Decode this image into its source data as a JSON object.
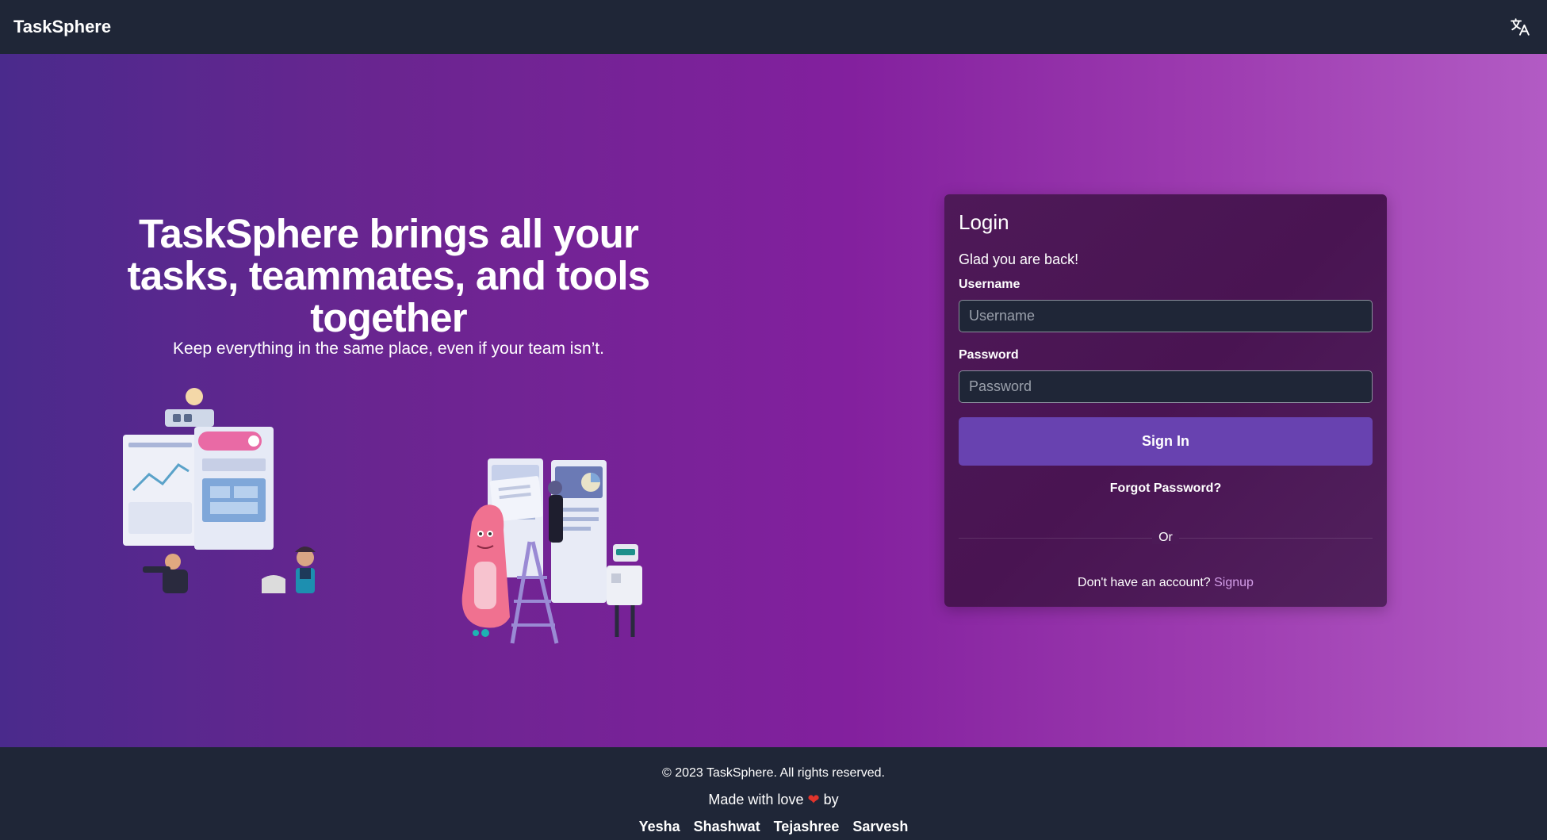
{
  "navbar": {
    "brand": "TaskSphere",
    "language_icon": "translate-icon"
  },
  "hero": {
    "headline": "TaskSphere brings all your tasks, teammates, and tools together",
    "subheadline": "Keep everything in the same place, even if your team isn’t."
  },
  "login": {
    "title": "Login",
    "subtitle": "Glad you are back!",
    "username_label": "Username",
    "username_placeholder": "Username",
    "password_label": "Password",
    "password_placeholder": "Password",
    "signin_label": "Sign In",
    "forgot_label": "Forgot Password?",
    "divider_text": "Or",
    "signup_prompt": "Don't have an account?",
    "signup_label": "Signup"
  },
  "footer": {
    "copyright": "© 2023 TaskSphere. All rights reserved.",
    "made_with": "Made with love",
    "heart": "❤",
    "by": "by",
    "authors": [
      "Yesha",
      "Shashwat",
      "Tejashree",
      "Sarvesh"
    ]
  },
  "colors": {
    "nav_bg": "#1f2637",
    "gradient_start": "#4a2a8c",
    "gradient_end": "#b25bc4",
    "card_bg": "#4e1958",
    "button_bg": "#6842b0",
    "link": "#d39ee8"
  }
}
